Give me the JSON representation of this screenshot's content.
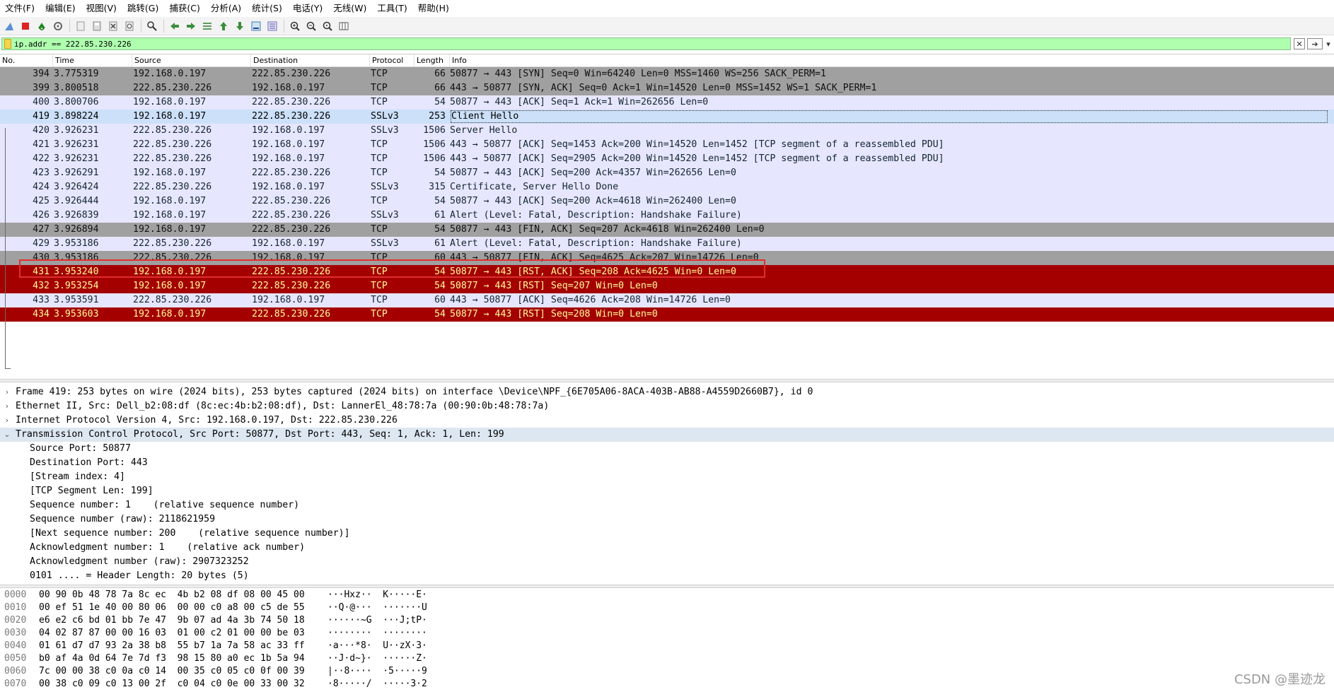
{
  "menu": [
    "文件(F)",
    "编辑(E)",
    "视图(V)",
    "跳转(G)",
    "捕获(C)",
    "分析(A)",
    "统计(S)",
    "电话(Y)",
    "无线(W)",
    "工具(T)",
    "帮助(H)"
  ],
  "toolbar_icons": [
    "shark-fin-icon",
    "stop-icon",
    "restart-icon",
    "options-gear-icon",
    "open-file-icon",
    "save-file-icon",
    "close-file-icon",
    "reload-file-icon",
    "find-icon",
    "go-back-icon",
    "go-forward-icon",
    "go-to-packet-icon",
    "first-packet-icon",
    "last-packet-icon",
    "autoscroll-icon",
    "colorize-icon",
    "zoom-in-icon",
    "zoom-out-icon",
    "zoom-normal-icon",
    "resize-columns-icon"
  ],
  "filter": {
    "value": "ip.addr == 222.85.230.226",
    "color": "#afffaf"
  },
  "columns": {
    "no": "No.",
    "time": "Time",
    "source": "Source",
    "destination": "Destination",
    "protocol": "Protocol",
    "length": "Length",
    "info": "Info"
  },
  "colors": {
    "gray_bg": "#a0a0a0",
    "lavender_bg": "#e7e6ff",
    "selected_bg": "#cce0f9",
    "rst_bg": "#a40000",
    "rst_fg": "#fffc9c",
    "highlight_border": "#e0302c"
  },
  "packets": [
    {
      "no": "394",
      "time": "3.775319",
      "src": "192.168.0.197",
      "dst": "222.85.230.226",
      "proto": "TCP",
      "len": "66",
      "info": "50877 → 443 [SYN] Seq=0 Win=64240 Len=0 MSS=1460 WS=256 SACK_PERM=1",
      "style": "gray"
    },
    {
      "no": "399",
      "time": "3.800518",
      "src": "222.85.230.226",
      "dst": "192.168.0.197",
      "proto": "TCP",
      "len": "66",
      "info": "443 → 50877 [SYN, ACK] Seq=0 Ack=1 Win=14520 Len=0 MSS=1452 WS=1 SACK_PERM=1",
      "style": "gray"
    },
    {
      "no": "400",
      "time": "3.800706",
      "src": "192.168.0.197",
      "dst": "222.85.230.226",
      "proto": "TCP",
      "len": "54",
      "info": "50877 → 443 [ACK] Seq=1 Ack=1 Win=262656 Len=0",
      "style": "lavender"
    },
    {
      "no": "419",
      "time": "3.898224",
      "src": "192.168.0.197",
      "dst": "222.85.230.226",
      "proto": "SSLv3",
      "len": "253",
      "info": "Client Hello",
      "style": "selected"
    },
    {
      "no": "420",
      "time": "3.926231",
      "src": "222.85.230.226",
      "dst": "192.168.0.197",
      "proto": "SSLv3",
      "len": "1506",
      "info": "Server Hello",
      "style": "lavender"
    },
    {
      "no": "421",
      "time": "3.926231",
      "src": "222.85.230.226",
      "dst": "192.168.0.197",
      "proto": "TCP",
      "len": "1506",
      "info": "443 → 50877 [ACK] Seq=1453 Ack=200 Win=14520 Len=1452 [TCP segment of a reassembled PDU]",
      "style": "lavender"
    },
    {
      "no": "422",
      "time": "3.926231",
      "src": "222.85.230.226",
      "dst": "192.168.0.197",
      "proto": "TCP",
      "len": "1506",
      "info": "443 → 50877 [ACK] Seq=2905 Ack=200 Win=14520 Len=1452 [TCP segment of a reassembled PDU]",
      "style": "lavender"
    },
    {
      "no": "423",
      "time": "3.926291",
      "src": "192.168.0.197",
      "dst": "222.85.230.226",
      "proto": "TCP",
      "len": "54",
      "info": "50877 → 443 [ACK] Seq=200 Ack=4357 Win=262656 Len=0",
      "style": "lavender"
    },
    {
      "no": "424",
      "time": "3.926424",
      "src": "222.85.230.226",
      "dst": "192.168.0.197",
      "proto": "SSLv3",
      "len": "315",
      "info": "Certificate, Server Hello Done",
      "style": "lavender"
    },
    {
      "no": "425",
      "time": "3.926444",
      "src": "192.168.0.197",
      "dst": "222.85.230.226",
      "proto": "TCP",
      "len": "54",
      "info": "50877 → 443 [ACK] Seq=200 Ack=4618 Win=262400 Len=0",
      "style": "lavender"
    },
    {
      "no": "426",
      "time": "3.926839",
      "src": "192.168.0.197",
      "dst": "222.85.230.226",
      "proto": "SSLv3",
      "len": "61",
      "info": "Alert (Level: Fatal, Description: Handshake Failure)",
      "style": "lavender"
    },
    {
      "no": "427",
      "time": "3.926894",
      "src": "192.168.0.197",
      "dst": "222.85.230.226",
      "proto": "TCP",
      "len": "54",
      "info": "50877 → 443 [FIN, ACK] Seq=207 Ack=4618 Win=262400 Len=0",
      "style": "gray"
    },
    {
      "no": "429",
      "time": "3.953186",
      "src": "222.85.230.226",
      "dst": "192.168.0.197",
      "proto": "SSLv3",
      "len": "61",
      "info": "Alert (Level: Fatal, Description: Handshake Failure)",
      "style": "lavender"
    },
    {
      "no": "430",
      "time": "3.953186",
      "src": "222.85.230.226",
      "dst": "192.168.0.197",
      "proto": "TCP",
      "len": "60",
      "info": "443 → 50877 [FIN, ACK] Seq=4625 Ack=207 Win=14726 Len=0",
      "style": "gray"
    },
    {
      "no": "431",
      "time": "3.953240",
      "src": "192.168.0.197",
      "dst": "222.85.230.226",
      "proto": "TCP",
      "len": "54",
      "info": "50877 → 443 [RST, ACK] Seq=208 Ack=4625 Win=0 Len=0",
      "style": "rst"
    },
    {
      "no": "432",
      "time": "3.953254",
      "src": "192.168.0.197",
      "dst": "222.85.230.226",
      "proto": "TCP",
      "len": "54",
      "info": "50877 → 443 [RST] Seq=207 Win=0 Len=0",
      "style": "rst"
    },
    {
      "no": "433",
      "time": "3.953591",
      "src": "222.85.230.226",
      "dst": "192.168.0.197",
      "proto": "TCP",
      "len": "60",
      "info": "443 → 50877 [ACK] Seq=4626 Ack=208 Win=14726 Len=0",
      "style": "lavender"
    },
    {
      "no": "434",
      "time": "3.953603",
      "src": "192.168.0.197",
      "dst": "222.85.230.226",
      "proto": "TCP",
      "len": "54",
      "info": "50877 → 443 [RST] Seq=208 Win=0 Len=0",
      "style": "rst"
    }
  ],
  "details": [
    {
      "text": "Frame 419: 253 bytes on wire (2024 bits), 253 bytes captured (2024 bits) on interface \\Device\\NPF_{6E705A06-8ACA-403B-AB88-A4559D2660B7}, id 0",
      "level": 0,
      "arrow": "collapsed"
    },
    {
      "text": "Ethernet II, Src: Dell_b2:08:df (8c:ec:4b:b2:08:df), Dst: LannerEl_48:78:7a (00:90:0b:48:78:7a)",
      "level": 0,
      "arrow": "collapsed"
    },
    {
      "text": "Internet Protocol Version 4, Src: 192.168.0.197, Dst: 222.85.230.226",
      "level": 0,
      "arrow": "collapsed"
    },
    {
      "text": "Transmission Control Protocol, Src Port: 50877, Dst Port: 443, Seq: 1, Ack: 1, Len: 199",
      "level": 0,
      "arrow": "expanded",
      "selected": true
    },
    {
      "text": "Source Port: 50877",
      "level": 1
    },
    {
      "text": "Destination Port: 443",
      "level": 1
    },
    {
      "text": "[Stream index: 4]",
      "level": 1
    },
    {
      "text": "[TCP Segment Len: 199]",
      "level": 1
    },
    {
      "text": "Sequence number: 1    (relative sequence number)",
      "level": 1
    },
    {
      "text": "Sequence number (raw): 2118621959",
      "level": 1
    },
    {
      "text": "[Next sequence number: 200    (relative sequence number)]",
      "level": 1
    },
    {
      "text": "Acknowledgment number: 1    (relative ack number)",
      "level": 1
    },
    {
      "text": "Acknowledgment number (raw): 2907323252",
      "level": 1
    },
    {
      "text": "0101 .... = Header Length: 20 bytes (5)",
      "level": 1
    }
  ],
  "bytes": [
    {
      "off": "0000",
      "hex": "00 90 0b 48 78 7a 8c ec  4b b2 08 df 08 00 45 00",
      "ascii": "···Hxz··  K·····E·"
    },
    {
      "off": "0010",
      "hex": "00 ef 51 1e 40 00 80 06  00 00 c0 a8 00 c5 de 55",
      "ascii": "··Q·@···  ·······U"
    },
    {
      "off": "0020",
      "hex": "e6 e2 c6 bd 01 bb 7e 47  9b 07 ad 4a 3b 74 50 18",
      "ascii": "······~G  ···J;tP·"
    },
    {
      "off": "0030",
      "hex": "04 02 87 87 00 00 16 03  01 00 c2 01 00 00 be 03",
      "ascii": "········  ········"
    },
    {
      "off": "0040",
      "hex": "01 61 d7 d7 93 2a 38 b8  55 b7 1a 7a 58 ac 33 ff",
      "ascii": "·a···*8·  U··zX·3·"
    },
    {
      "off": "0050",
      "hex": "b0 af 4a 0d 64 7e 7d f3  98 15 80 a0 ec 1b 5a 94",
      "ascii": "··J·d~}·  ······Z·"
    },
    {
      "off": "0060",
      "hex": "7c 00 00 38 c0 0a c0 14  00 35 c0 05 c0 0f 00 39",
      "ascii": "|··8····  ·5·····9"
    },
    {
      "off": "0070",
      "hex": "00 38 c0 09 c0 13 00 2f  c0 04 c0 0e 00 33 00 32",
      "ascii": "·8·····/  ·····3·2"
    }
  ],
  "watermark": "CSDN @墨迹龙"
}
